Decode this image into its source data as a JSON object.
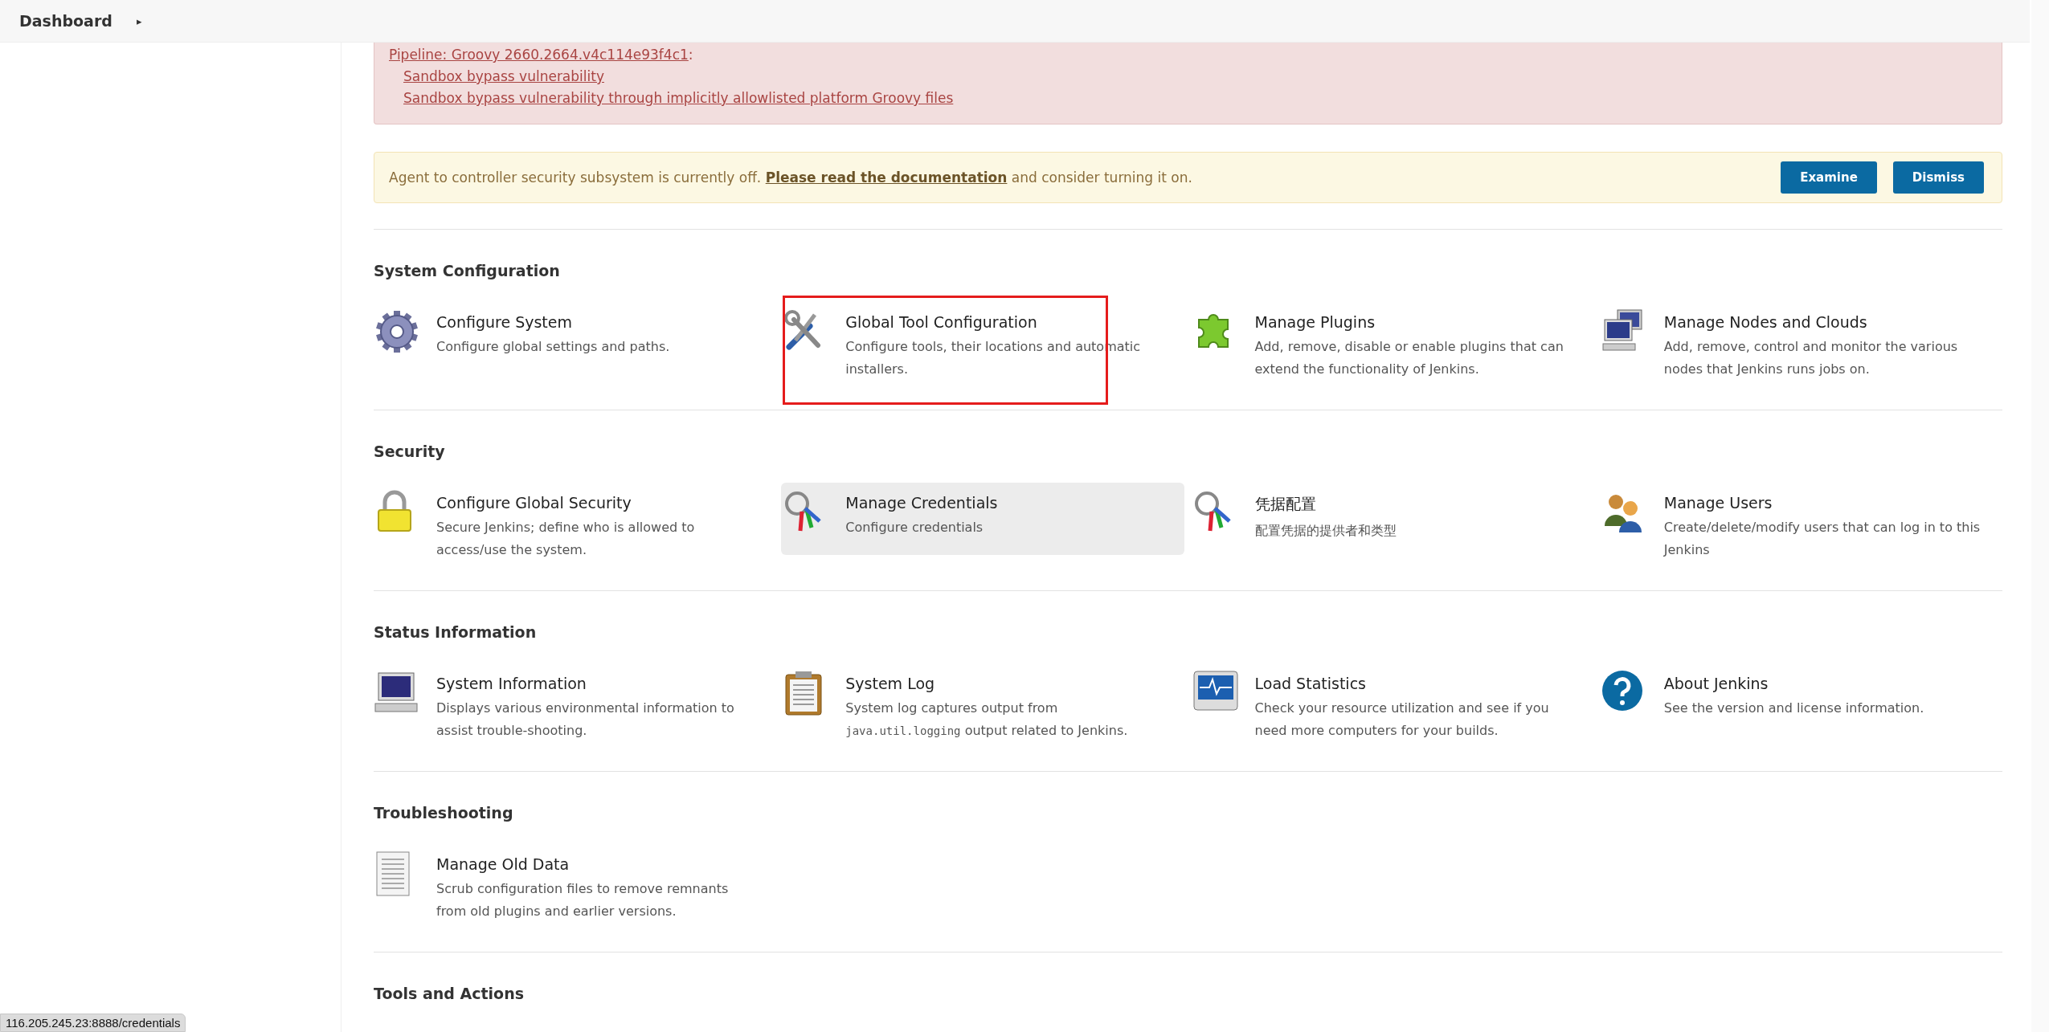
{
  "breadcrumb": {
    "label": "Dashboard",
    "caret": "▸"
  },
  "danger_alert": {
    "heading_link": "Pipeline: Groovy 2660.2664.v4c114e93f4c1",
    "heading_suffix": ":",
    "links": [
      "Sandbox bypass vulnerability",
      "Sandbox bypass vulnerability through implicitly allowlisted platform Groovy files"
    ]
  },
  "warning_alert": {
    "text_before": "Agent to controller security subsystem is currently off. ",
    "link": "Please read the documentation",
    "text_after": " and consider turning it on.",
    "buttons": [
      "Examine",
      "Dismiss"
    ]
  },
  "sections": [
    {
      "title": "System Configuration",
      "items": [
        {
          "title": "Configure System",
          "description": [
            {
              "kind": "text",
              "text": "Configure global settings and paths."
            }
          ],
          "hovered": false,
          "highlighted": false
        },
        {
          "title": "Global Tool Configuration",
          "description": [
            {
              "kind": "text",
              "text": "Configure tools, their locations and automatic installers."
            }
          ],
          "hovered": false,
          "highlighted": true
        },
        {
          "title": "Manage Plugins",
          "description": [
            {
              "kind": "text",
              "text": "Add, remove, disable or enable plugins that can extend the functionality of Jenkins."
            }
          ],
          "hovered": false,
          "highlighted": false
        },
        {
          "title": "Manage Nodes and Clouds",
          "description": [
            {
              "kind": "text",
              "text": "Add, remove, control and monitor the various nodes that Jenkins runs jobs on."
            }
          ],
          "hovered": false,
          "highlighted": false
        }
      ]
    },
    {
      "title": "Security",
      "items": [
        {
          "title": "Configure Global Security",
          "description": [
            {
              "kind": "text",
              "text": "Secure Jenkins; define who is allowed to access/use the system."
            }
          ],
          "hovered": false,
          "highlighted": false
        },
        {
          "title": "Manage Credentials",
          "description": [
            {
              "kind": "text",
              "text": "Configure credentials"
            }
          ],
          "hovered": true,
          "highlighted": false
        },
        {
          "title": "凭据配置",
          "description": [
            {
              "kind": "text",
              "text": "配置凭据的提供者和类型"
            }
          ],
          "hovered": false,
          "highlighted": false
        },
        {
          "title": "Manage Users",
          "description": [
            {
              "kind": "text",
              "text": "Create/delete/modify users that can log in to this Jenkins"
            }
          ],
          "hovered": false,
          "highlighted": false
        }
      ]
    },
    {
      "title": "Status Information",
      "items": [
        {
          "title": "System Information",
          "description": [
            {
              "kind": "text",
              "text": "Displays various environmental information to assist trouble-shooting."
            }
          ],
          "hovered": false,
          "highlighted": false
        },
        {
          "title": "System Log",
          "description": [
            {
              "kind": "text",
              "text": "System log captures output from "
            },
            {
              "kind": "code",
              "text": "java.util.logging"
            },
            {
              "kind": "text",
              "text": " output related to Jenkins."
            }
          ],
          "hovered": false,
          "highlighted": false
        },
        {
          "title": "Load Statistics",
          "description": [
            {
              "kind": "text",
              "text": "Check your resource utilization and see if you need more computers for your builds."
            }
          ],
          "hovered": false,
          "highlighted": false
        },
        {
          "title": "About Jenkins",
          "description": [
            {
              "kind": "text",
              "text": "See the version and license information."
            }
          ],
          "hovered": false,
          "highlighted": false
        }
      ]
    },
    {
      "title": "Troubleshooting",
      "items": [
        {
          "title": "Manage Old Data",
          "description": [
            {
              "kind": "text",
              "text": "Scrub configuration files to remove remnants from old plugins and earlier versions."
            }
          ],
          "hovered": false,
          "highlighted": false
        }
      ]
    },
    {
      "title": "Tools and Actions"
    }
  ],
  "status_url": "116.205.245.23:8888/credentials"
}
